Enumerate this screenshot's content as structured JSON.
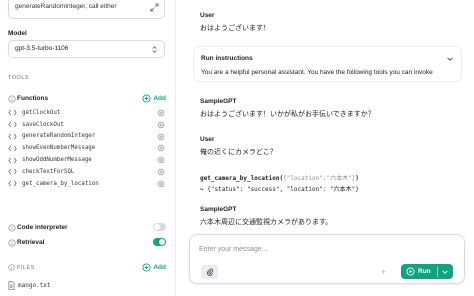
{
  "instructions": {
    "text": "generateRandomInteger, call either"
  },
  "model": {
    "label": "Model",
    "value": "gpt-3.5-turbo-1106"
  },
  "tools": {
    "section_label": "TOOLS",
    "functions": {
      "title": "Functions",
      "add_label": "Add",
      "items": [
        "getClockOut",
        "saveClockOut",
        "generateRandomInteger",
        "showEvenNumberMessage",
        "showOddNumberMessage",
        "checkTextForSQL",
        "get_camera_by_location"
      ]
    },
    "code_interpreter": {
      "title": "Code interpreter",
      "enabled": false
    },
    "retrieval": {
      "title": "Retrieval",
      "enabled": true
    }
  },
  "files": {
    "section_label": "FILES",
    "add_label": "Add",
    "items": [
      "mango.txt"
    ]
  },
  "thread": {
    "m1": {
      "role": "User",
      "text": "おはようございます！"
    },
    "run": {
      "title": "Run instructions",
      "text": "You are a helpful personal assistant. You have the following tools you can invoke"
    },
    "m2": {
      "role": "SampleGPT",
      "text": "おはようございます！いかが私がお手伝いできますか？"
    },
    "m3": {
      "role": "User",
      "text": "俺の近くにカメラどこ？"
    },
    "call": {
      "name": "get_camera_by_location",
      "open": "(",
      "args": "{\"location\":\"六本木\"}",
      "close": ")",
      "result": "↪ {\"status\": \"success\", \"location\": \"六本木\"}"
    },
    "m4": {
      "role": "SampleGPT",
      "text": "六本木周辺に交通監視カメラがあります。"
    }
  },
  "composer": {
    "placeholder": "Enter your message...",
    "run_label": "Run"
  },
  "colors": {
    "accent": "#10a37f",
    "border": "#d9d9e3",
    "muted": "#6e6e80"
  }
}
